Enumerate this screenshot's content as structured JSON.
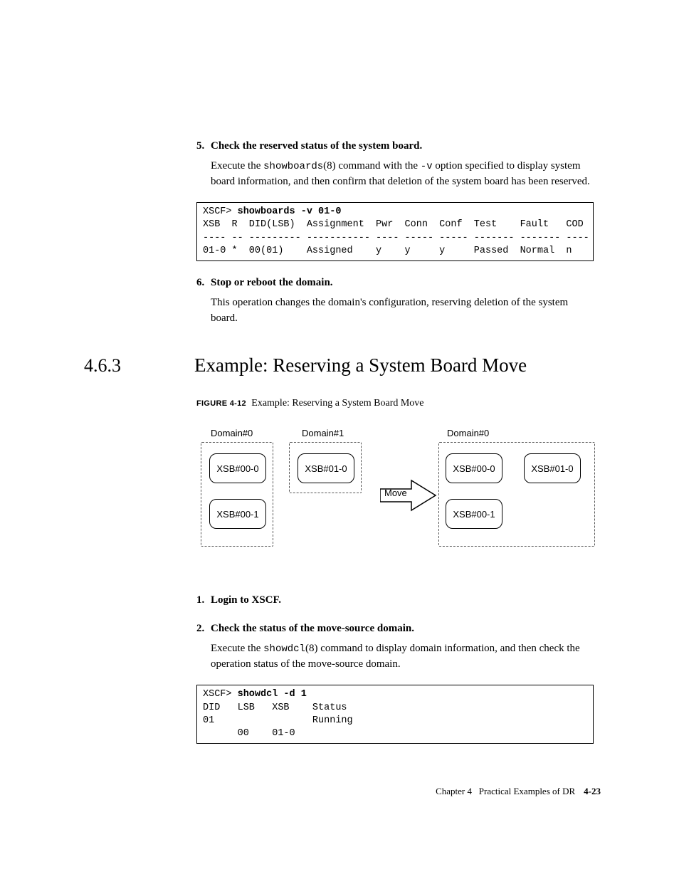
{
  "step5": {
    "num": "5.",
    "title": "Check the reserved status of the system board.",
    "body1": "Execute the ",
    "cmd1": "showboards",
    "body2": "(8) command with the ",
    "opt": "-v",
    "body3": " option specified to display system board information, and then confirm that deletion of the system board has been reserved."
  },
  "code1": {
    "prompt": "XSCF> ",
    "cmd": "showboards -v 01-0",
    "line2": "XSB  R  DID(LSB)  Assignment  Pwr  Conn  Conf  Test    Fault   COD",
    "line3": "---- -- --------- ----------- ---- ----- ----- ------- ------- ----",
    "line4": "01-0 *  00(01)    Assigned    y    y     y     Passed  Normal  n"
  },
  "step6": {
    "num": "6.",
    "title": "Stop or reboot the domain.",
    "body": "This operation changes the domain's configuration, reserving deletion of the system board."
  },
  "section": {
    "num": "4.6.3",
    "title": "Example: Reserving a System Board Move"
  },
  "figcap": {
    "strong": "FIGURE 4-12",
    "text": "Example: Reserving a System Board Move"
  },
  "figure": {
    "domain0a": "Domain#0",
    "domain1": "Domain#1",
    "domain0b": "Domain#0",
    "xsb000": "XSB#00-0",
    "xsb001": "XSB#00-1",
    "xsb010": "XSB#01-0",
    "move": "Move"
  },
  "step1": {
    "num": "1.",
    "title": "Login to XSCF."
  },
  "step2": {
    "num": "2.",
    "title": "Check the status of the move-source domain.",
    "body1": "Execute the ",
    "cmd": "showdcl",
    "body2": "(8) command to display domain information, and then check the operation status of the move-source domain."
  },
  "code2": {
    "prompt": "XSCF> ",
    "cmd": "showdcl -d 1",
    "line2": "DID   LSB   XSB    Status",
    "line3": "01                 Running",
    "line4": "      00    01-0"
  },
  "footer": {
    "chapter": "Chapter 4",
    "title": "Practical Examples of DR",
    "page": "4-23"
  }
}
